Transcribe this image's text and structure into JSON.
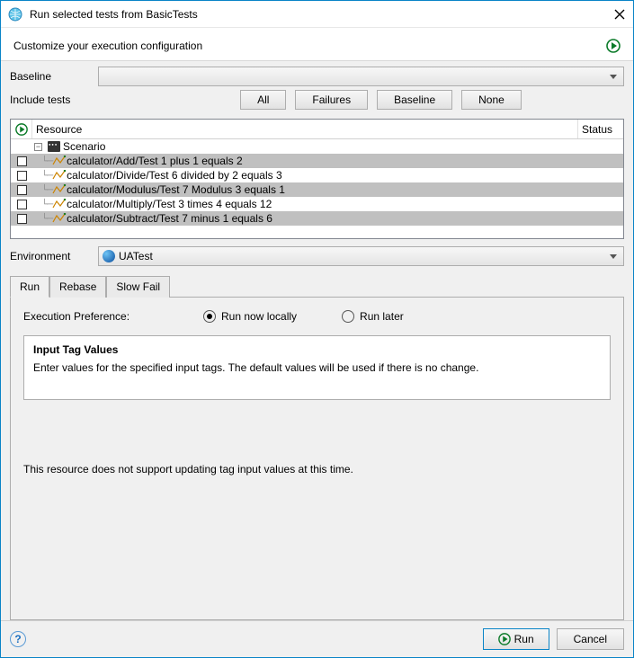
{
  "title": "Run selected tests from BasicTests",
  "header_message": "Customize your execution configuration",
  "labels": {
    "baseline": "Baseline",
    "include_tests": "Include tests",
    "environment": "Environment",
    "exec_pref": "Execution Preference:"
  },
  "filter_buttons": {
    "all": "All",
    "failures": "Failures",
    "baseline": "Baseline",
    "none": "None"
  },
  "tree": {
    "header_resource": "Resource",
    "header_status": "Status",
    "scenario_label": "Scenario",
    "items": [
      "calculator/Add/Test 1 plus 1 equals 2",
      "calculator/Divide/Test 6 divided by  2 equals 3",
      "calculator/Modulus/Test 7 Modulus 3 equals 1",
      "calculator/Multiply/Test 3 times 4 equals 12",
      "calculator/Subtract/Test 7 minus 1 equals 6"
    ]
  },
  "environment_value": "UATest",
  "tabs": {
    "run": "Run",
    "rebase": "Rebase",
    "slowfail": "Slow Fail"
  },
  "radios": {
    "local": "Run now locally",
    "later": "Run later"
  },
  "input_tag": {
    "title": "Input Tag Values",
    "desc": "Enter values for the specified input tags. The default values will be used if there is no change."
  },
  "notice": "This resource does not support updating tag input values at this time.",
  "footer": {
    "run": "Run",
    "cancel": "Cancel"
  }
}
